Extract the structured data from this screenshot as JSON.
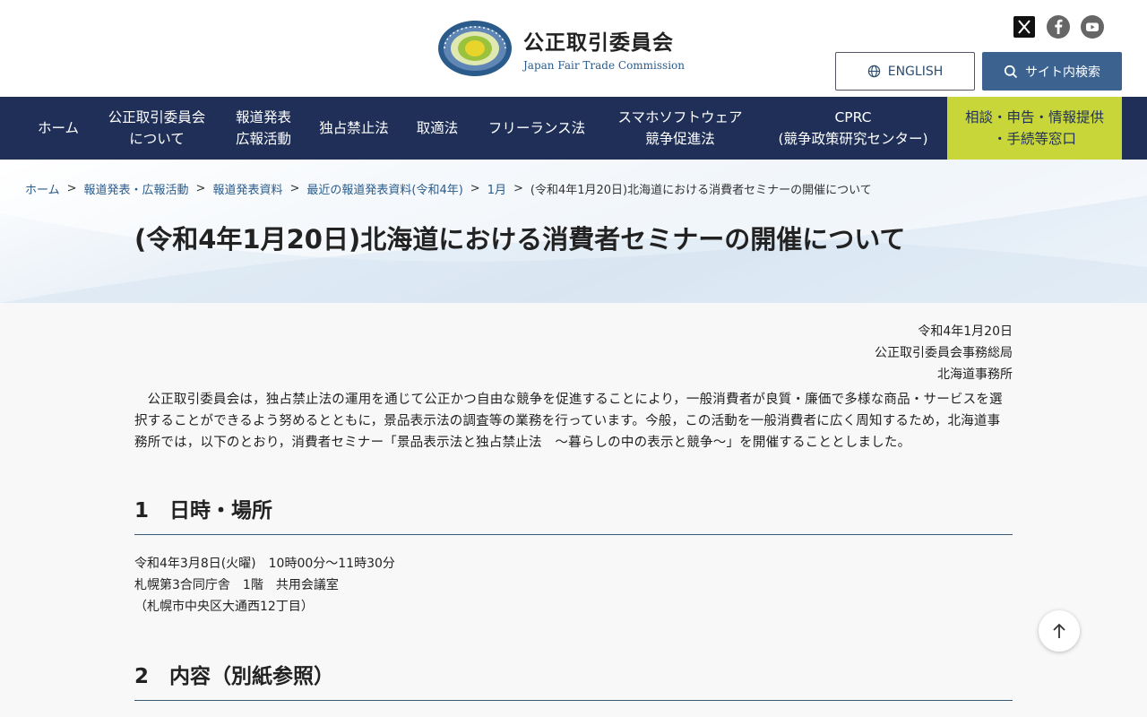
{
  "header": {
    "logo_ja": "公正取引委員会",
    "logo_en": "Japan Fair Trade Commission",
    "english_label": "ENGLISH",
    "search_label": "サイト内検索",
    "social": [
      "x-icon",
      "facebook-icon",
      "youtube-icon"
    ]
  },
  "nav": [
    {
      "label": "ホーム"
    },
    {
      "label": "公正取引委員会\nについて"
    },
    {
      "label": "報道発表\n広報活動"
    },
    {
      "label": "独占禁止法"
    },
    {
      "label": "取適法"
    },
    {
      "label": "フリーランス法"
    },
    {
      "label": "スマホソフトウェア\n競争促進法"
    },
    {
      "label": "CPRC\n(競争政策研究センター)"
    },
    {
      "label": "相談・申告・情報提供\n・手続等窓口"
    }
  ],
  "breadcrumb": {
    "links": [
      "ホーム",
      "報道発表・広報活動",
      "報道発表資料",
      "最近の報道発表資料(令和4年)",
      "1月"
    ],
    "separator": ">",
    "current": "(令和4年1月20日)北海道における消費者セミナーの開催について"
  },
  "page_title": "(令和4年1月20日)北海道における消費者セミナーの開催について",
  "meta": {
    "date": "令和4年1月20日",
    "org": "公正取引委員会事務総局",
    "office": "北海道事務所"
  },
  "intro": "公正取引委員会は，独占禁止法の運用を通じて公正かつ自由な競争を促進することにより，一般消費者が良質・廉価で多様な商品・サービスを選択することができるよう努めるとともに，景品表示法の調査等の業務を行っています。今般，この活動を一般消費者に広く周知するため，北海道事務所では，以下のとおり，消費者セミナー「景品表示法と独占禁止法　～暮らしの中の表示と競争～」を開催することとしました。",
  "sections": [
    {
      "heading": "1　日時・場所",
      "lines": [
        "令和4年3月8日(火曜)　10時00分～11時30分",
        "札幌第3合同庁舎　1階　共用会議室",
        "（札幌市中央区大通西12丁目）"
      ]
    },
    {
      "heading": "2　内容（別紙参照）"
    }
  ],
  "colors": {
    "nav_bg": "#1f2f57",
    "consult_bg": "#c9d639",
    "accent_blue": "#3c6390",
    "link": "#2a5b8a"
  }
}
